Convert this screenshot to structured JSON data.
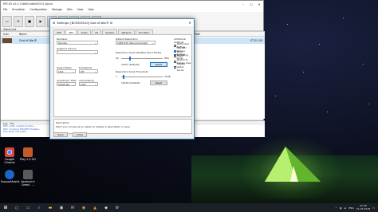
{
  "main_window": {
    "title": "RPCS3 v0.0.3-6860-b8e06313 Alpha",
    "menu": [
      "File",
      "Emulation",
      "Configuration",
      "Manage",
      "Utils",
      "View",
      "Help"
    ],
    "toolbar_icons": [
      "open-icon",
      "refresh-icon",
      "stop-icon",
      "start-icon",
      "gear-icon",
      "pad-icon",
      "list-icon",
      "grid-icon",
      "zoom-icon"
    ],
    "game_list_label": "Game List",
    "columns": [
      "Icon",
      "Name",
      "Serial",
      "Firmware",
      "Version",
      "Category",
      "Path"
    ],
    "game_row": {
      "name": "God of War®",
      "serial": "BCES00510",
      "version_right": "ST 01.00"
    },
    "log_tabs": [
      "Log",
      "TTY"
    ],
    "log_lines": [
      "PPU: LLVM: Loaded module ...",
      "RSX: 'Cooking' PPU/SPU threads...",
      "SYS: Boot successful."
    ]
  },
  "dialog": {
    "title": "Settings: [BCES00510] God of War® III",
    "tabs": [
      "CPU",
      "GPU",
      "Audio",
      "I/O",
      "System",
      "Network",
      "Emulator"
    ],
    "active_tab": "GPU",
    "renderer_label": "Renderer",
    "renderer_value": "OpenGL",
    "graphics_device_label": "Graphics Device",
    "graphics_device_value": "",
    "aspect_ratio_label": "Aspect Ratio",
    "aspect_ratio_value": "16:9",
    "framelimit_label": "Framelimit",
    "framelimit_value": "Off",
    "anisotropic_label": "Anisotropic Filter",
    "anisotropic_value": "Automatic",
    "antialiasing_label": "Anti-Aliasing",
    "antialiasing_value": "Auto",
    "default_resolution_label": "Default Resolution",
    "default_resolution_value": "1280x720 (Recommended)",
    "resolution_scale_label": "Resolution Scale (Disable Strict Mode)",
    "resolution_scale_min": "50",
    "resolution_scale_max": "800",
    "resolution_scale_value": "100% (Default)",
    "threshold_label": "Resolution Scale Threshold",
    "threshold_min": "1",
    "threshold_max": "2048",
    "threshold_value": "16x16 (Default)",
    "reset_label": "Reset",
    "additional_settings_label": "Additional Settings",
    "checkboxes": [
      {
        "label": "Write Color Buffers",
        "checked": false
      },
      {
        "label": "Use GPU Texture Scaling",
        "checked": true
      },
      {
        "label": "Strict Rendering Mode",
        "checked": false
      },
      {
        "label": "VSync",
        "checked": false
      },
      {
        "label": "Stretch To Display Area",
        "checked": false
      },
      {
        "label": "Disable Vertex Cache",
        "checked": false
      }
    ],
    "description_label": "Description",
    "description_text": "Point your mouse at an option to display a description in here.",
    "save_label": "Save",
    "close_label": "Close"
  },
  "desktop_icons": [
    {
      "label": "Google Chrome",
      "color": "#e8e8e8"
    },
    {
      "label": "Play 2.5 GO",
      "color": "#c25a2a"
    },
    {
      "label": "SupportAssist",
      "color": "#1e63c8"
    },
    {
      "label": "Assassin's Creed - ...",
      "color": "#5a5a5a"
    }
  ],
  "taskbar": {
    "icons": [
      "start-icon",
      "search-icon",
      "task-view-icon",
      "edge-icon",
      "explorer-icon",
      "store-icon",
      "mail-icon",
      "chrome-icon",
      "vlc-icon",
      "rpcs3-icon",
      "settings-icon"
    ],
    "time": "22:46",
    "date": "31-03-2018",
    "lang": "ENG"
  }
}
